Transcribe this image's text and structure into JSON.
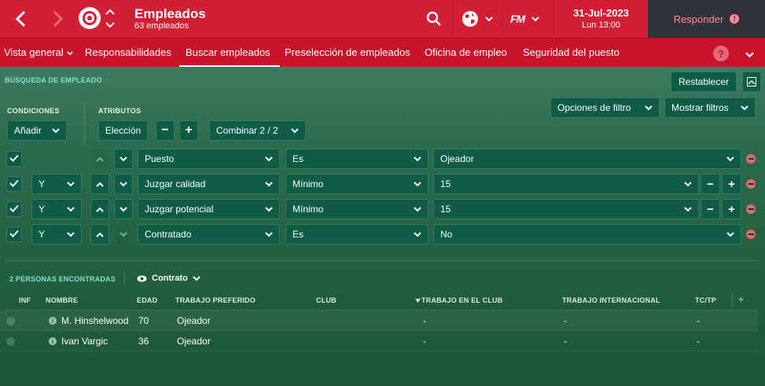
{
  "header": {
    "title": "Empleados",
    "subtitle": "63 empleados",
    "fm_logo": "FM",
    "date": "31-Jul-2023",
    "time": "Lun 13:00",
    "respond_label": "Responder",
    "respond_badge": "!"
  },
  "tabs": [
    {
      "label": "Vista general",
      "has_menu": true
    },
    {
      "label": "Responsabilidades"
    },
    {
      "label": "Buscar empleados",
      "active": true
    },
    {
      "label": "Preselección de empleados"
    },
    {
      "label": "Oficina de empleo"
    },
    {
      "label": "Seguridad del puesto"
    }
  ],
  "help_label": "?",
  "search": {
    "section_title": "BÚSQUEDA DE EMPLEADO",
    "reset_label": "Restablecer",
    "conditions_label": "CONDICIONES",
    "add_label": "Añadir",
    "attributes_label": "ATRIBUTOS",
    "choice_label": "Elección",
    "minus_label": "−",
    "plus_label": "+",
    "combine_label": "Combinar 2 / 2",
    "filter_options_label": "Opciones de filtro",
    "show_filters_label": "Mostrar filtros"
  },
  "filters": [
    {
      "logic": "",
      "field": "Puesto",
      "operator": "Es",
      "value": "Ojeador",
      "stepper": false
    },
    {
      "logic": "Y",
      "field": "Juzgar calidad",
      "operator": "Mínimo",
      "value": "15",
      "stepper": true
    },
    {
      "logic": "Y",
      "field": "Juzgar potencial",
      "operator": "Mínimo",
      "value": "15",
      "stepper": true
    },
    {
      "logic": "Y",
      "field": "Contratado",
      "operator": "Es",
      "value": "No",
      "stepper": false
    }
  ],
  "results": {
    "found_label": "2 PERSONAS ENCONTRADAS",
    "view_label": "Contrato",
    "columns": [
      "INF",
      "NOMBRE",
      "EDAD",
      "TRABAJO PREFERIDO",
      "CLUB",
      "TRABAJO EN EL CLUB",
      "TRABAJO INTERNACIONAL",
      "TC/TP"
    ],
    "add_column_label": "+",
    "rows": [
      {
        "name": "M. Hinshelwood",
        "age": "70",
        "job": "Ojeador",
        "club": "",
        "club_job": "-",
        "intl_job": "-",
        "tctp": "-"
      },
      {
        "name": "Ivan Vargic",
        "age": "36",
        "job": "Ojeador",
        "club": "",
        "club_job": "-",
        "intl_job": "-",
        "tctp": "-"
      }
    ]
  },
  "colors": {
    "header_red": "#d21f34",
    "tab_red": "#c8132a",
    "respond_bg": "#2f3339",
    "respond_text": "#ff8a95",
    "panel_green": "#0e5c45",
    "accent_cyan": "#7fe0d8"
  },
  "icons": [
    "back-arrow-icon",
    "forward-arrow-icon",
    "club-crest-icon",
    "up-down-icon",
    "search-icon",
    "globe-icon",
    "fm-logo-icon",
    "alert-icon",
    "help-icon",
    "chevron-down-icon",
    "check-icon",
    "remove-icon",
    "eye-icon",
    "sort-down-icon",
    "info-icon"
  ]
}
